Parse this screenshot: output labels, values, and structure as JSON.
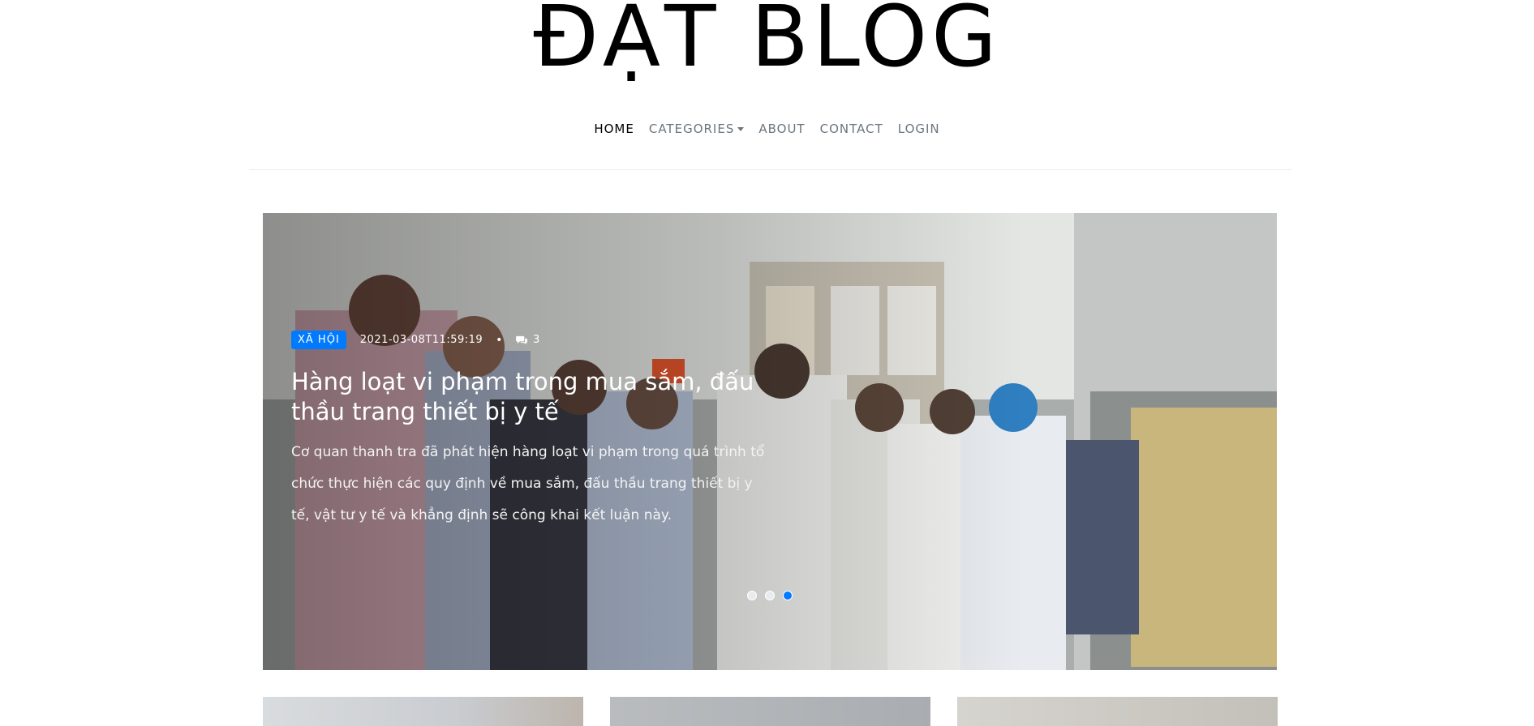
{
  "site": {
    "title": "ĐẠT BLOG"
  },
  "nav": {
    "items": [
      {
        "label": "HOME",
        "active": true
      },
      {
        "label": "CATEGORIES",
        "dropdown": true
      },
      {
        "label": "ABOUT"
      },
      {
        "label": "CONTACT"
      },
      {
        "label": "LOGIN"
      }
    ]
  },
  "carousel": {
    "active_slide": 3,
    "slide_count": 3,
    "slide": {
      "category": "XÃ HỘI",
      "date": "2021-03-08T11:59:19",
      "separator": "•",
      "comment_count": "3",
      "title": "Hàng loạt vi phạm trong mua sắm, đấu thầu trang thiết bị y tế",
      "excerpt": "Cơ quan thanh tra đã phát hiện hàng loạt vi phạm trong quá trình tổ chức thực hiện các quy định về mua sắm, đấu thầu trang thiết bị y tế, vật tư y tế và khẳng định sẽ công khai kết luận này."
    }
  },
  "colors": {
    "accent": "#007bff",
    "nav_active": "#000000",
    "nav_inactive": "#6c757d"
  },
  "icons": {
    "comment": "comments-icon",
    "dropdown": "caret-down-icon"
  }
}
